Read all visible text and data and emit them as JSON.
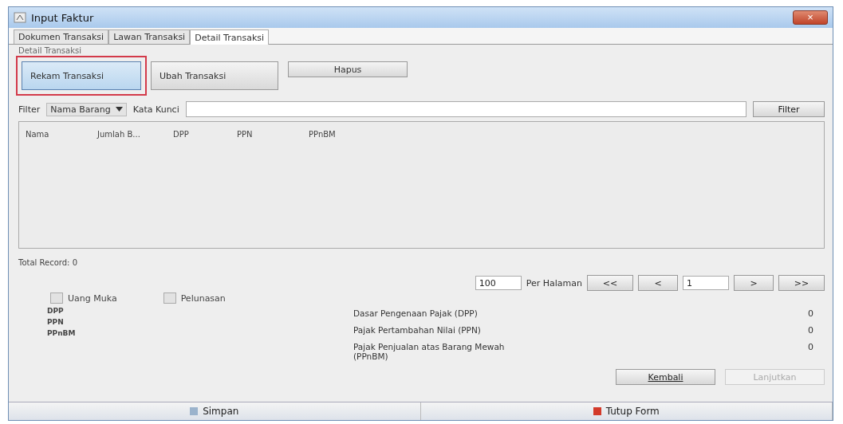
{
  "window": {
    "title": "Input Faktur",
    "close": "×"
  },
  "tabs": [
    {
      "label": "Dokumen Transaksi",
      "selected": false
    },
    {
      "label": "Lawan Transaksi",
      "selected": false
    },
    {
      "label": "Detail Transaksi",
      "selected": true
    }
  ],
  "section_title": "Detail Transaksi",
  "actions": [
    {
      "label": "Rekam Transaksi",
      "selected": true
    },
    {
      "label": "Ubah Transaksi",
      "selected": false
    },
    {
      "label": "Hapus",
      "selected": false
    }
  ],
  "filter": {
    "label": "Filter",
    "field": "Nama Barang",
    "keyword_label": "Kata Kunci",
    "button": "Filter"
  },
  "table": {
    "columns": [
      "Nama",
      "Jumlah B...",
      "DPP",
      "PPN",
      "PPnBM"
    ]
  },
  "total_record": "Total Record: 0",
  "pagination": {
    "per_page": "100",
    "per_page_label": "Per Halaman",
    "first": "<<",
    "prev": "<",
    "page": "1",
    "next": ">",
    "last": ">>"
  },
  "options": [
    {
      "label": "Uang Muka",
      "checked": false
    },
    {
      "label": "Pelunasan",
      "checked": false
    }
  ],
  "labels": [
    "DPP",
    "PPN",
    "PPnBM"
  ],
  "summary": [
    {
      "label": "Dasar Pengenaan Pajak (DPP)",
      "value": "0"
    },
    {
      "label": "Pajak Pertambahan Nilai (PPN)",
      "value": "0"
    },
    {
      "label": "Pajak Penjualan atas Barang Mewah (PPnBM)",
      "value": "0"
    }
  ],
  "nav_buttons": [
    {
      "label": "Kembali",
      "disabled": false
    },
    {
      "label": "Lanjutkan",
      "disabled": true
    }
  ],
  "footer": [
    {
      "label": "Simpan",
      "kind": "save"
    },
    {
      "label": "Tutup Form",
      "kind": "close"
    }
  ]
}
